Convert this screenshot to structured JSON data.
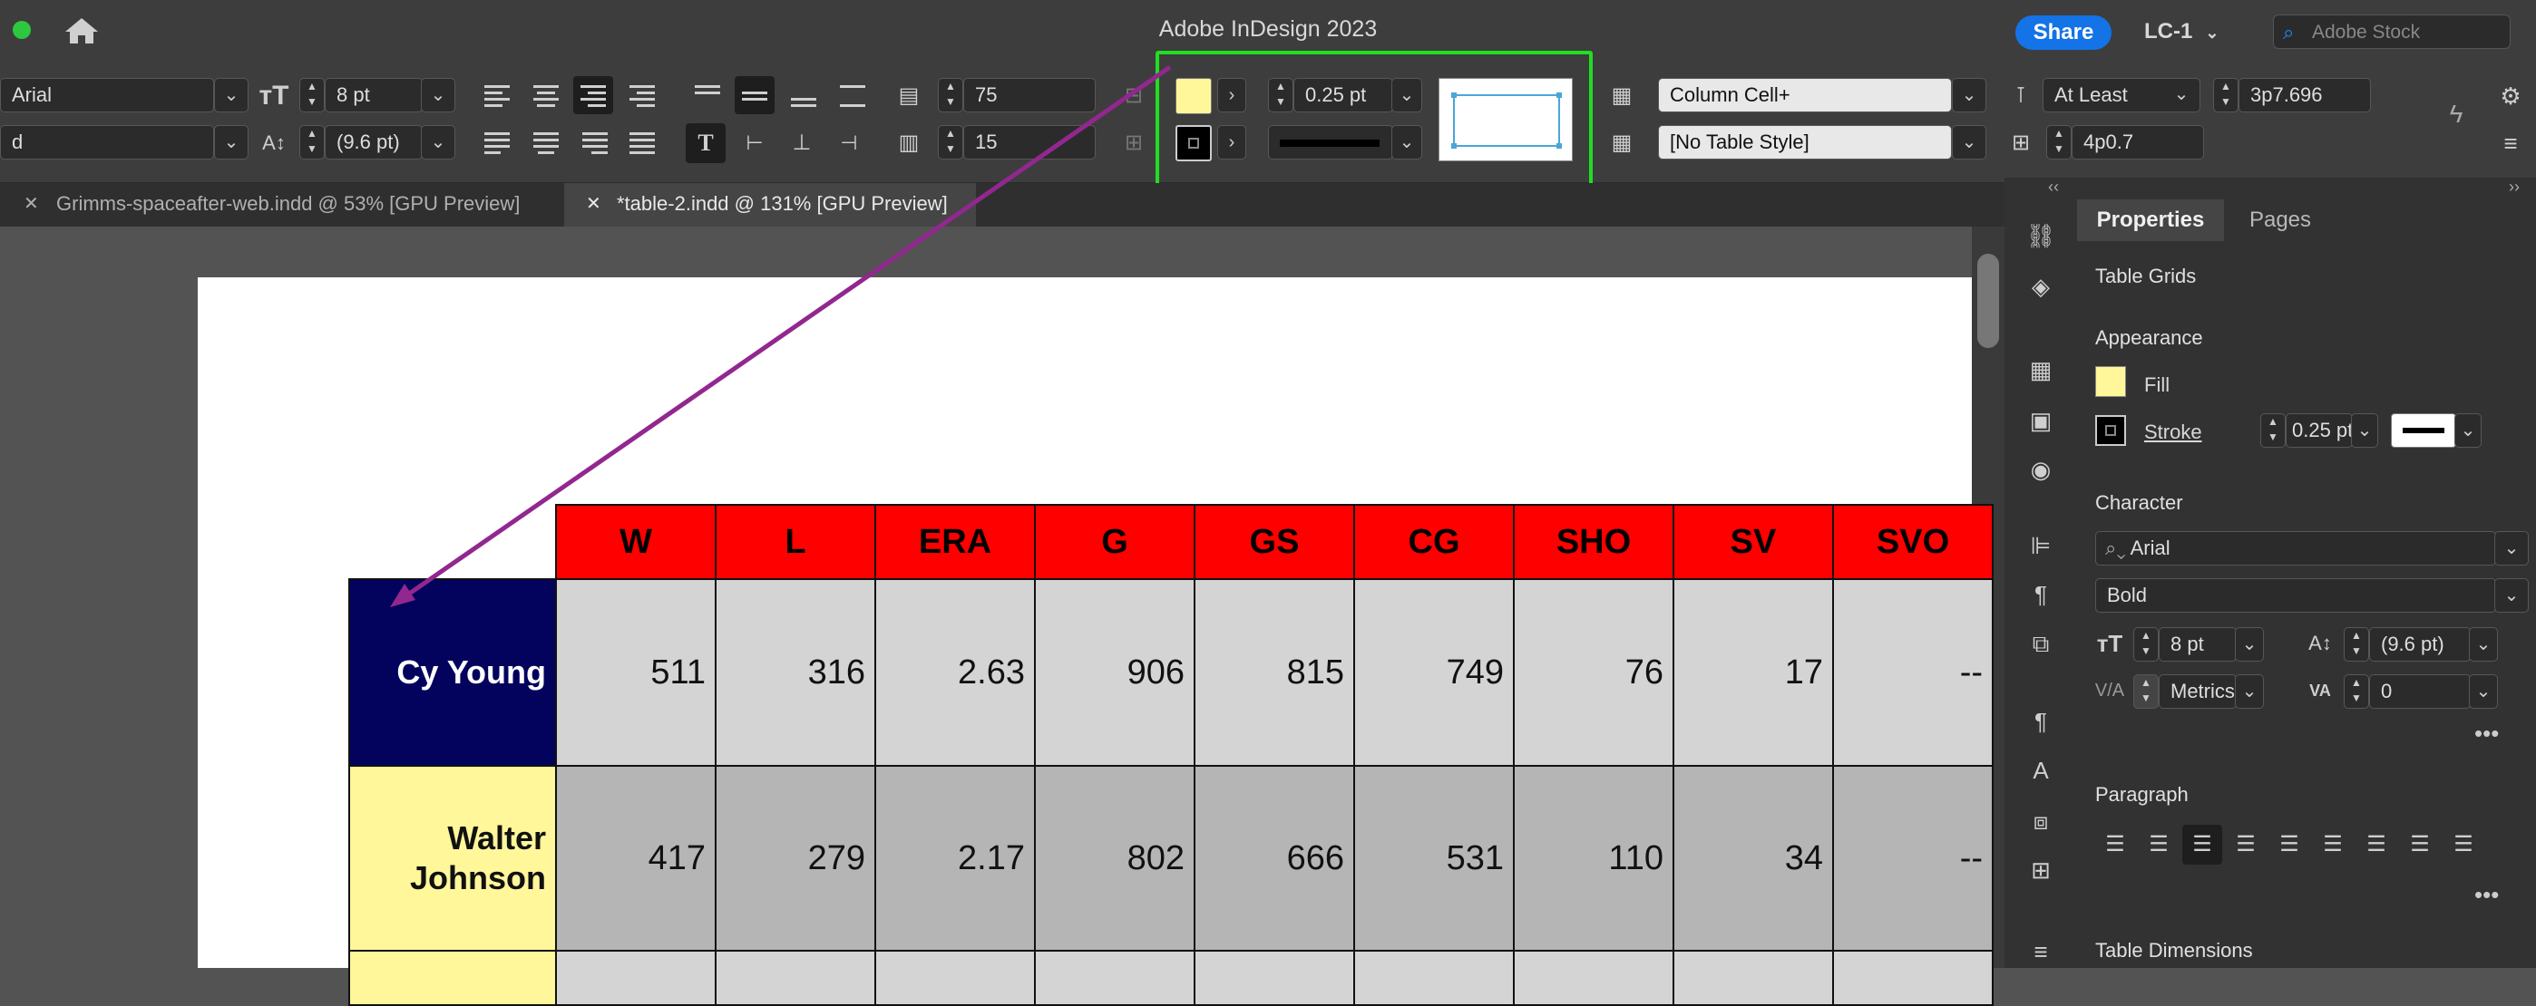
{
  "app": {
    "title": "Adobe InDesign 2023",
    "share_label": "Share",
    "workspace": "LC-1",
    "stock_placeholder": "Adobe Stock"
  },
  "control": {
    "font_family": "Arial",
    "font_style_partial": "d",
    "font_size": "8 pt",
    "leading": "(9.6 pt)",
    "rows": "75",
    "columns": "15",
    "stroke_weight": "0.25 pt",
    "cell_style": "Column Cell+",
    "table_style": "[No Table Style]",
    "row_height_mode": "At Least",
    "row_height": "3p7.696",
    "column_width": "4p0.7",
    "fill_color": "#fff79a"
  },
  "tabs": [
    {
      "label": "Grimms-spaceafter-web.indd @ 53% [GPU Preview]"
    },
    {
      "label": "*table-2.indd @ 131% [GPU Preview]"
    }
  ],
  "table": {
    "headers": [
      "W",
      "L",
      "ERA",
      "G",
      "GS",
      "CG",
      "SHO",
      "SV",
      "SVO"
    ],
    "rows": [
      {
        "name": "Cy Young",
        "values": [
          "511",
          "316",
          "2.63",
          "906",
          "815",
          "749",
          "76",
          "17",
          "--"
        ]
      },
      {
        "name": "Walter Johnson",
        "values": [
          "417",
          "279",
          "2.17",
          "802",
          "666",
          "531",
          "110",
          "34",
          "--"
        ]
      }
    ]
  },
  "panel": {
    "tabs": [
      "Properties",
      "Pages"
    ],
    "subtitle": "Table Grids",
    "appearance": {
      "title": "Appearance",
      "fill": "Fill",
      "stroke": "Stroke",
      "stroke_weight": "0.25 pt"
    },
    "character": {
      "title": "Character",
      "font": "Arial",
      "style": "Bold",
      "size": "8 pt",
      "leading": "(9.6 pt)",
      "kerning": "Metrics",
      "tracking": "0"
    },
    "paragraph": {
      "title": "Paragraph"
    },
    "table_dims": {
      "title": "Table Dimensions"
    }
  }
}
